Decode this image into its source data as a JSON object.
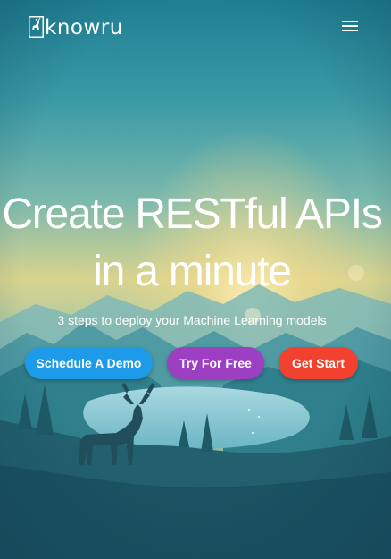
{
  "header": {
    "logo_text": "knowru",
    "logo_icon": "deer-icon",
    "menu_icon": "hamburger-menu-icon"
  },
  "hero": {
    "title_line1": "Create RESTful APIs",
    "title_line2": "in a minute",
    "subtitle": "3 steps to deploy your Machine Learning models"
  },
  "buttons": {
    "schedule_demo": "Schedule A Demo",
    "try_free": "Try For Free",
    "get_start": "Get Start"
  },
  "colors": {
    "demo_button": "#1e9be8",
    "free_button": "#9c3fc2",
    "start_button": "#f2412e",
    "sky_top": "#2a8fa0",
    "sky_glow": "#f3d886"
  }
}
